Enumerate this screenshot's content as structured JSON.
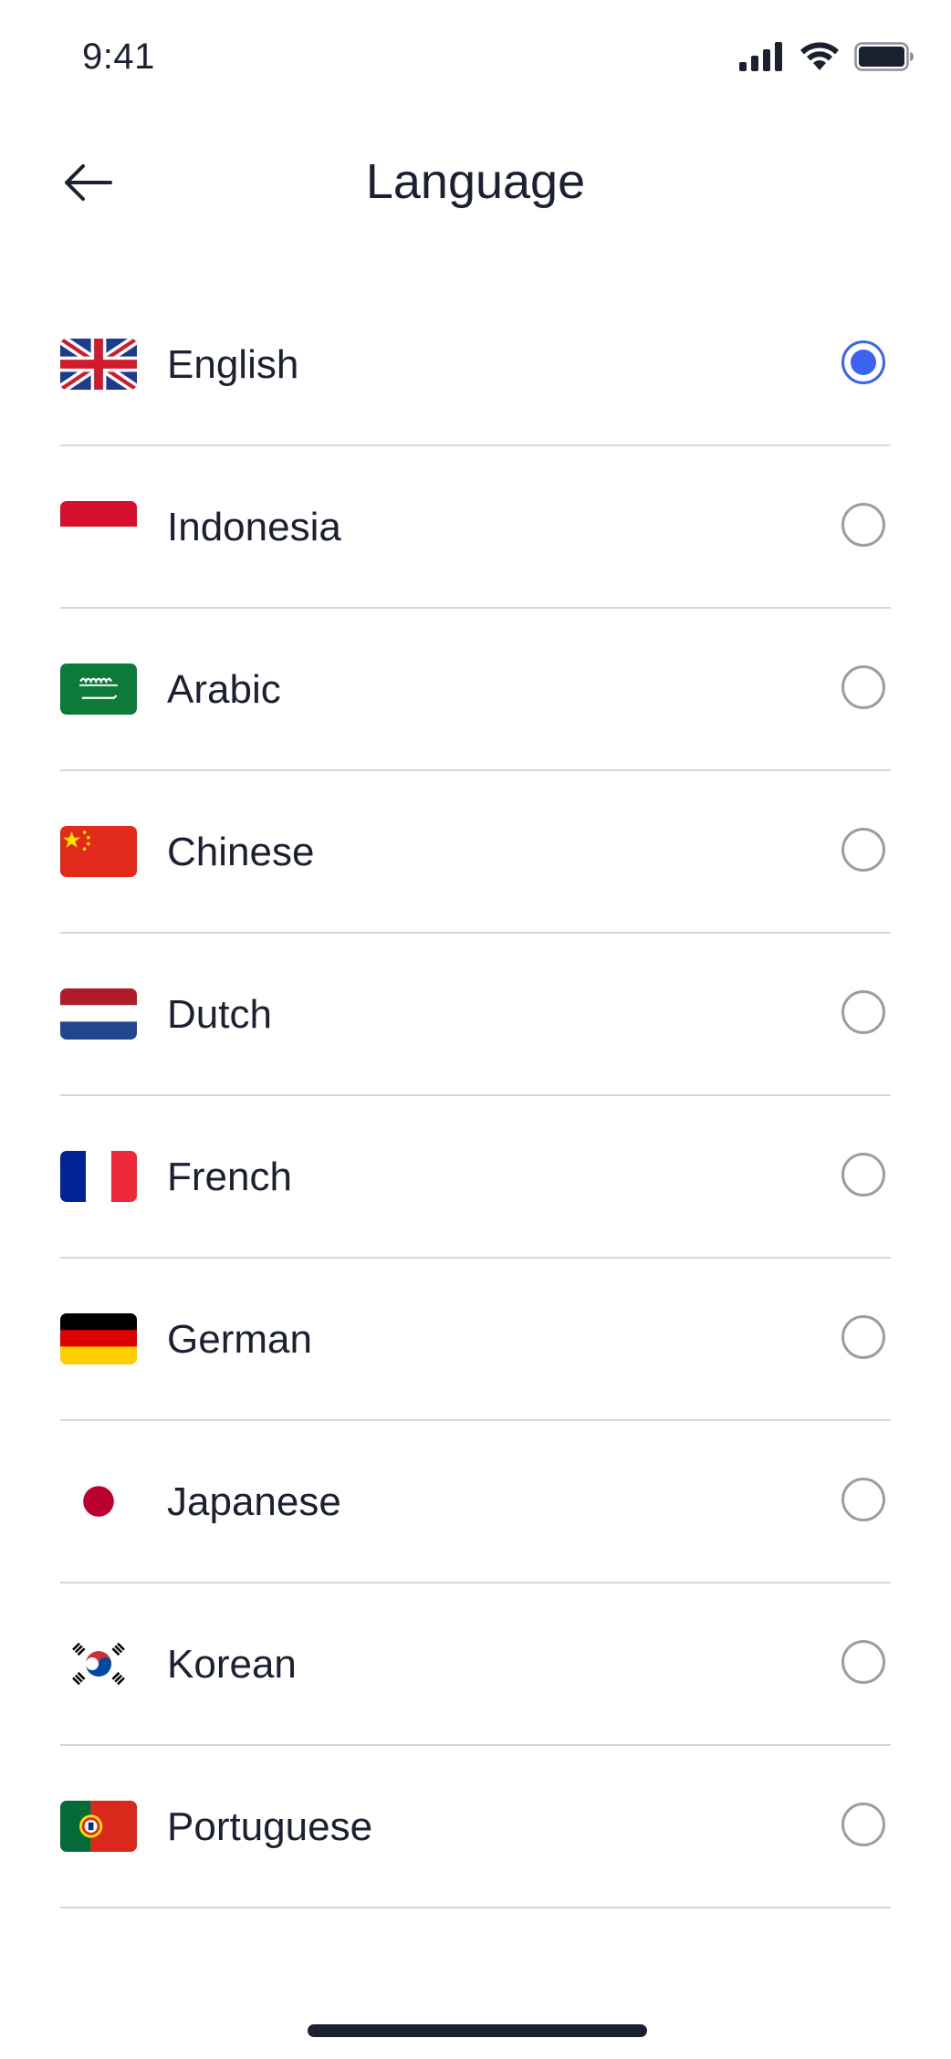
{
  "status_bar": {
    "time": "9:41",
    "icons": [
      "signal-icon",
      "wifi-icon",
      "battery-icon"
    ]
  },
  "header": {
    "back_icon": "arrow-left-icon",
    "title": "Language"
  },
  "languages": [
    {
      "label": "English",
      "flag": "uk-flag-icon",
      "selected": true
    },
    {
      "label": "Indonesia",
      "flag": "indonesia-flag-icon",
      "selected": false
    },
    {
      "label": "Arabic",
      "flag": "saudi-arabia-flag-icon",
      "selected": false
    },
    {
      "label": "Chinese",
      "flag": "china-flag-icon",
      "selected": false
    },
    {
      "label": "Dutch",
      "flag": "netherlands-flag-icon",
      "selected": false
    },
    {
      "label": "French",
      "flag": "france-flag-icon",
      "selected": false
    },
    {
      "label": "German",
      "flag": "germany-flag-icon",
      "selected": false
    },
    {
      "label": "Japanese",
      "flag": "japan-flag-icon",
      "selected": false
    },
    {
      "label": "Korean",
      "flag": "korea-flag-icon",
      "selected": false
    },
    {
      "label": "Portuguese",
      "flag": "portugal-flag-icon",
      "selected": false
    }
  ],
  "colors": {
    "accent": "#3b63f0",
    "text": "#1b2130",
    "divider": "#d4d6db",
    "radio_border": "#9a9da3"
  }
}
